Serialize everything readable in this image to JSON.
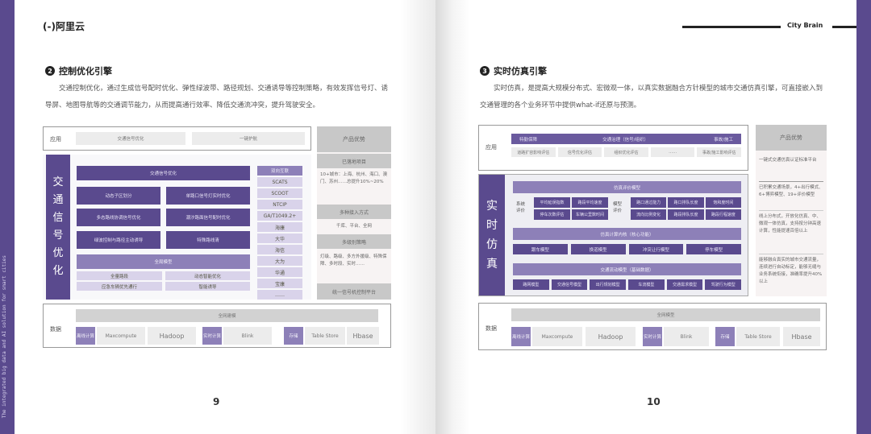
{
  "left_page": {
    "logo": "(-)阿里云",
    "side_text": "The integrated big data and AI solution for smart cities",
    "section_num": "2",
    "section_title": "控制优化引擎",
    "paragraph": "交通控制优化，通过生成信号配时优化、弹性绿波带、路径规划、交通诱导等控制策略，有效发挥信号灯、诱导屏、地图导航等的交通调节能力，从而提高通行效率、降低交通流冲突，提升驾驶安全。",
    "app_label": "应用",
    "app_items": [
      "交通信号优化",
      "一键护航"
    ],
    "vertical_title": [
      "交",
      "通",
      "信",
      "号",
      "优",
      "化"
    ],
    "main_header": "交通信号优化",
    "main_items": [
      "动态子区划分",
      "单路口信号灯实时优化",
      "多态路线协调信号优化",
      "潮汐路面信号配时优化",
      "绿波控制与路径主动诱导",
      "特殊路线清"
    ],
    "network_header": "全局模型",
    "network_items": [
      "全量路段",
      "动态智能优化",
      "应急车辆优先通行",
      "智能诱导"
    ],
    "protocol_header": "双向互联",
    "protocols": [
      "SCATS",
      "SCOOT",
      "NTCIP",
      "GA/T1049.2+",
      "海康",
      "大华",
      "海信",
      "大为",
      "华通",
      "宝康",
      "……"
    ],
    "adv_title": "产品优势",
    "advantages": [
      {
        "h": "已落地项目",
        "t": "10+城市：上海、杭州、海口、澳门、苏州……总提升10%~20%"
      },
      {
        "h": "多种接入方式",
        "t": "千库、平台、全网"
      },
      {
        "h": "多级别策略",
        "t": "灯级、路级、多方外援级、特殊保障、多时段、实时……"
      },
      {
        "h": "统一信号机控制平台",
        "t": ""
      }
    ],
    "data_label": "数据",
    "data_header": "全网建模",
    "data_items": [
      {
        "tag": "离线计算",
        "items": [
          "Maxcompute",
          "Hadoop"
        ]
      },
      {
        "tag": "实时计算",
        "items": [
          "Blink"
        ]
      },
      {
        "tag": "存储",
        "items": [
          "Table Store",
          "Hbase"
        ]
      }
    ],
    "page_number": "9"
  },
  "right_page": {
    "brand": "City Brain",
    "section_num": "3",
    "section_title": "实时仿真引擎",
    "paragraph": "实时仿真，是提高大规模分布式、宏微观一体，以真实数据融合方针模型的城市交通仿真引擎，可直接嵌入到交通管理的各个业务环节中提供what-if还原与预测。",
    "app_label": "应用",
    "app_bar": [
      "特勤保障",
      "交通治理（信号/组织）",
      "事故/施工"
    ],
    "app_items": [
      "道路扩容影响评估",
      "信号优化评估",
      "组织优化评估",
      "……",
      "事故/施工影响评估"
    ],
    "vertical_title": [
      "实",
      "时",
      "仿",
      "真"
    ],
    "eval_header": "仿真评价模型",
    "sys_label": "系统评价",
    "sys_items": [
      "平均延误指数",
      "路段平均速度",
      "停车次数评估",
      "车辆公里数时间"
    ],
    "model_label": "模型评价",
    "model_items": [
      "路口通过能力",
      "路口排队长度",
      "饱和度时间",
      "流向比例变化",
      "路段排队长度",
      "路段行程速度"
    ],
    "engine_header": "仿真计算内核（核心功能）",
    "engine_items": [
      "跟车模型",
      "换道模型",
      "冲突让行模型",
      "停车模型"
    ],
    "flow_header": "交通流动模型（基础数据）",
    "flow_items": [
      "路网模型",
      "交通信号模型",
      "出行规划模型",
      "车流模型",
      "交通需求模型",
      "驾驶行为模型"
    ],
    "adv_title": "产品优势",
    "advantages": [
      "一键式交通仿真认证标准平台",
      "已积累交通场景，4+出行模式、6+博弈模型、19+评价模型",
      "线上分布式，开放化仿真、中、微观一体仿真，支持按分钟高速计算，性能提速百倍以上",
      "能够融合真实的城市交通流量，连续进行自动标定，能够无缝与业务系统衔接，准确率提升40%以上"
    ],
    "data_label": "数据",
    "data_header": "全网模型",
    "data_items": [
      {
        "tag": "离线计算",
        "items": [
          "Maxcompute",
          "Hadoop"
        ]
      },
      {
        "tag": "实时计算",
        "items": [
          "Blink"
        ]
      },
      {
        "tag": "存储",
        "items": [
          "Table Store",
          "Hbase"
        ]
      }
    ],
    "page_number": "10"
  },
  "colors": {
    "accent": "#5a4a8e",
    "light_accent": "#8d80b8"
  }
}
